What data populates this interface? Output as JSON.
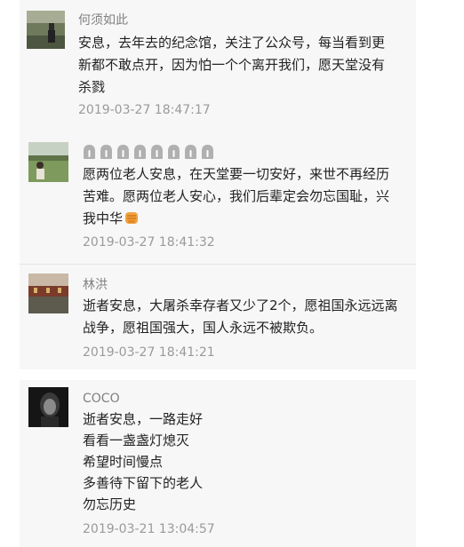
{
  "colors": {
    "panel_bg": "#f7f7f7",
    "nickname": "#808080",
    "content_text": "#222222",
    "timestamp": "#9a9a9a",
    "divider": "#e5e5e5"
  },
  "comments": [
    {
      "nickname": "何须如此",
      "avatar_icon": "person-in-field-avatar",
      "lines": [
        "安息，去年去的纪念馆，关注了公众号，每当看到更",
        "新都不敢点开，因为怕一个个离开我们，愿天堂没有",
        "杀戮"
      ],
      "time": "2019-03-27 18:47:17"
    },
    {
      "nickname_icons": [
        "pray-emoji",
        "pray-emoji",
        "pray-emoji",
        "pray-emoji",
        "pray-emoji",
        "pray-emoji",
        "pray-emoji",
        "pray-emoji"
      ],
      "avatar_icon": "girl-on-lawn-avatar",
      "lines": [
        "愿两位老人安息，在天堂要一切安好，来世不再经历",
        "苦难。愿两位老人安心，我们后辈定会勿忘国耻，兴",
        "我中华"
      ],
      "trailing_icon": "fist-emoji",
      "time": "2019-03-27 18:41:32"
    },
    {
      "nickname": "林洪",
      "avatar_icon": "river-town-avatar",
      "lines": [
        "逝者安息，大屠杀幸存者又少了2个，愿祖国永远远离",
        "战争，愿祖国强大，国人永远不被欺负。"
      ],
      "time": "2019-03-27 18:41:21"
    },
    {
      "nickname": "COCO",
      "avatar_icon": "dark-portrait-avatar",
      "lines": [
        "逝者安息，一路走好",
        "看看一盏盏灯熄灭",
        "希望时间慢点",
        "多善待下留下的老人",
        "勿忘历史"
      ],
      "time": "2019-03-21 13:04:57"
    }
  ]
}
